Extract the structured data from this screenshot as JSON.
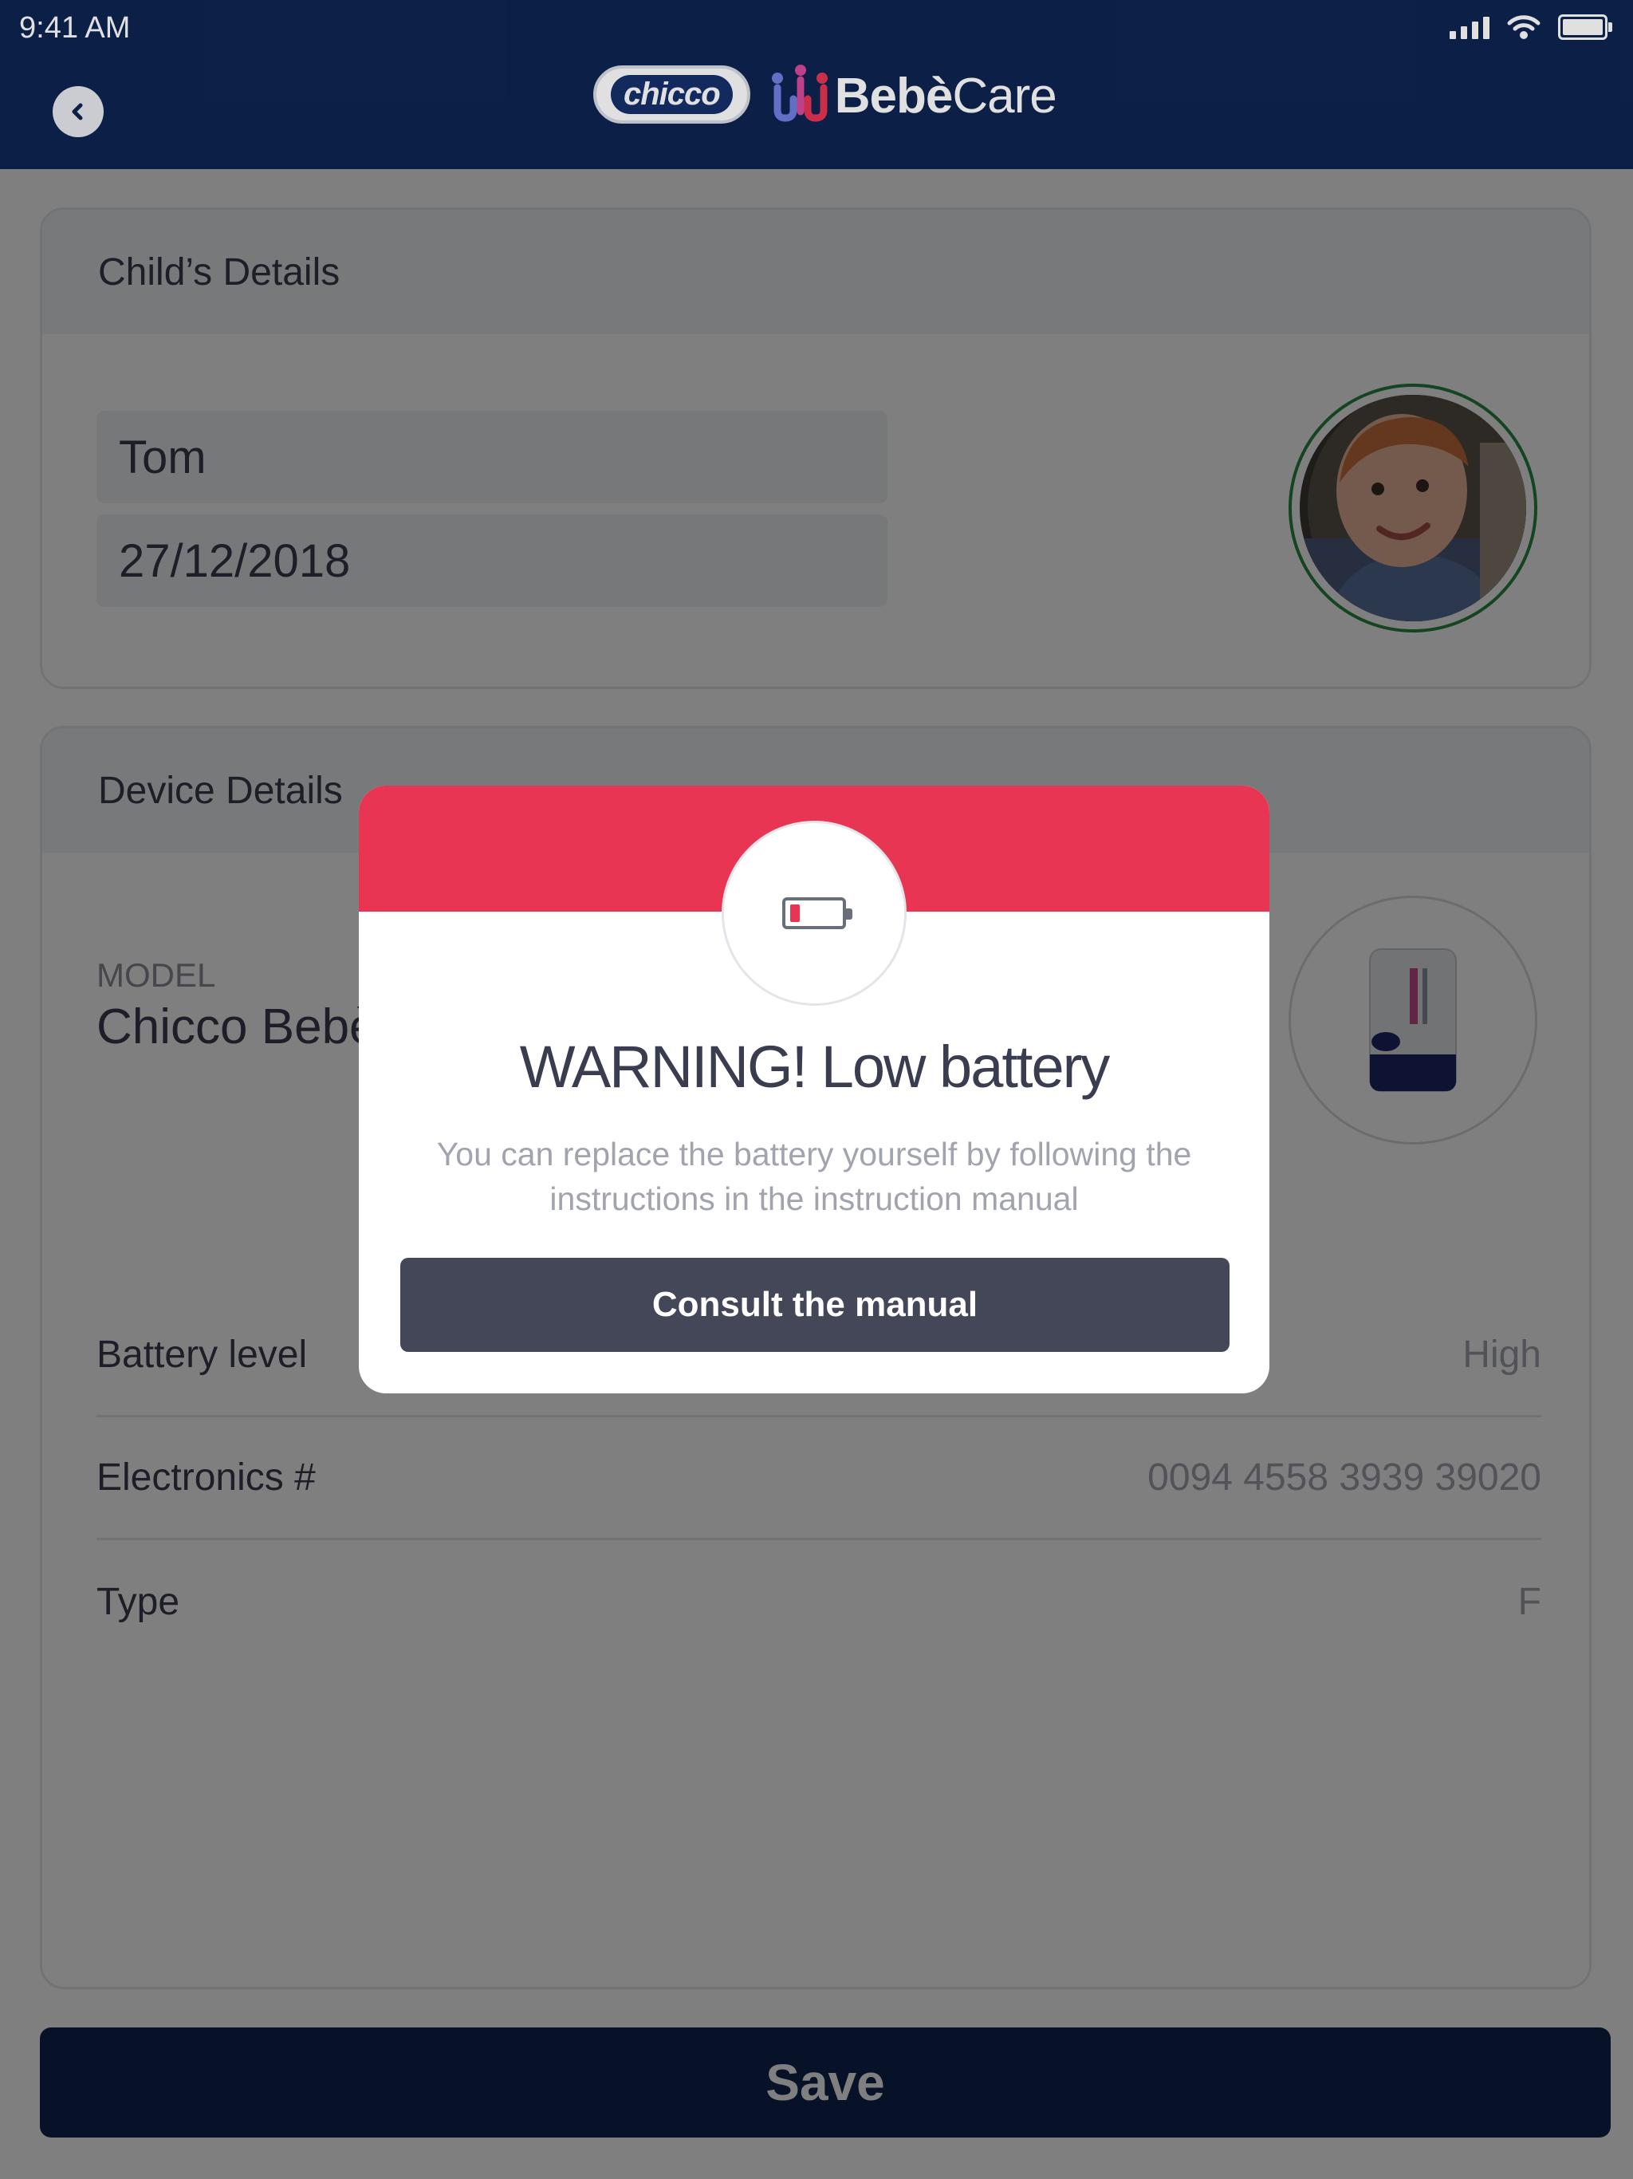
{
  "status_bar": {
    "time": "9:41 AM"
  },
  "header": {
    "brand_chicco": "chicco",
    "brand_bebe": "Bebè",
    "brand_care": "Care"
  },
  "child_details": {
    "title": "Child’s Details",
    "name": "Tom",
    "birth_date": "27/12/2018"
  },
  "device_details": {
    "title": "Device Details",
    "model_label": "MODEL",
    "model_name": "Chicco Bebè Care Easy-tech",
    "rows": [
      {
        "label": "Battery level",
        "value": "High"
      },
      {
        "label": "Electronics #",
        "value": "0094 4558 3939 39020"
      },
      {
        "label": "Type",
        "value": "F"
      }
    ]
  },
  "actions": {
    "save_label": "Save"
  },
  "modal": {
    "title": "WARNING! Low battery",
    "message": "You can replace the battery yourself by following the instructions in the instruction manual",
    "button_label": "Consult the manual",
    "battery_level_fraction": 0.2
  },
  "colors": {
    "nav_bar": "#0e2551",
    "warning_red": "#e73553",
    "modal_button": "#434758",
    "avatar_ring": "#2a8a40"
  },
  "icons": {
    "back": "chevron-left-icon",
    "battery_warning": "low-battery-icon",
    "signal": "cellular-signal-icon",
    "wifi": "wifi-icon",
    "status_battery": "battery-full-icon"
  }
}
